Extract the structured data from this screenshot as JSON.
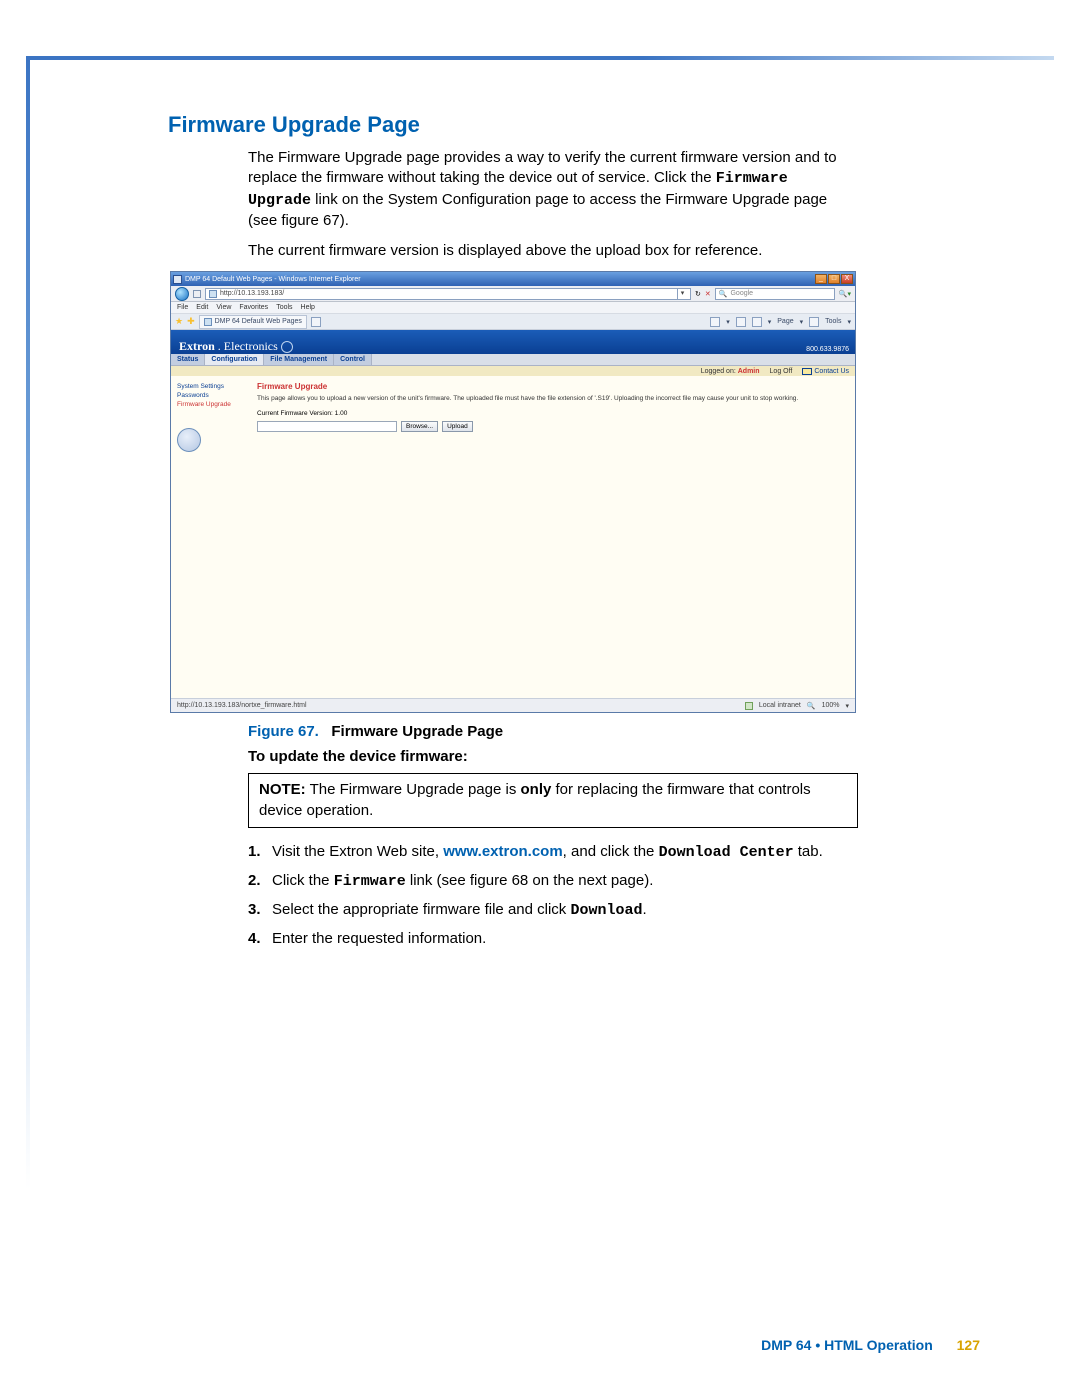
{
  "heading": "Firmware Upgrade Page",
  "para1_part1": "The Firmware Upgrade page provides a way to verify the current firmware version and to replace the firmware without taking the device out of service. Click the ",
  "para1_code": "Firmware Upgrade",
  "para1_part2": " link on the System Configuration page to access the Firmware Upgrade page (see figure 67).",
  "para2": "The current firmware version is displayed above the upload box for reference.",
  "figure": {
    "num": "Figure 67.",
    "title": "Firmware Upgrade Page"
  },
  "subhead": "To update the device firmware:",
  "note_label": "NOTE:",
  "note_text_a": " The Firmware Upgrade page is ",
  "note_bold": "only",
  "note_text_b": " for replacing the firmware that controls device operation.",
  "steps": {
    "s1_a": "Visit the Extron Web site, ",
    "s1_link": "www.extron.com",
    "s1_b": ", and click the ",
    "s1_code": "Download Center",
    "s1_c": " tab.",
    "s2_a": "Click the ",
    "s2_code": "Firmware",
    "s2_b": " link (see figure 68 on the next page).",
    "s3_a": "Select the appropriate firmware file and click ",
    "s3_code": "Download",
    "s3_b": ".",
    "s4": "Enter the requested information."
  },
  "footer": {
    "label": "DMP 64 • HTML Operation",
    "page": "127"
  },
  "ie": {
    "title": "DMP 64 Default Web Pages - Windows Internet Explorer",
    "url": "http://10.13.193.183/",
    "search_hint": "Google",
    "menus": [
      "File",
      "Edit",
      "View",
      "Favorites",
      "Tools",
      "Help"
    ],
    "tab": "DMP 64 Default Web Pages",
    "tools": {
      "page": "Page",
      "tools": "Tools"
    },
    "status_url": "http://10.13.193.183/nortxe_firmware.html",
    "zone": "Local intranet",
    "zoom": "100%"
  },
  "extron": {
    "brand_a": "Extron",
    "brand_b": "Electronics",
    "phone": "800.633.9876",
    "tabs": [
      "Status",
      "Configuration",
      "File Management",
      "Control"
    ],
    "strip": {
      "loggedon_label": "Logged on:",
      "loggedon_user": "Admin",
      "logoff": "Log Off",
      "contact": "Contact Us"
    },
    "sidebar": {
      "l1": "System Settings",
      "l2": "Passwords",
      "l3": "Firmware Upgrade"
    },
    "fw": {
      "title": "Firmware Upgrade",
      "desc": "This page allows you to upload a new version of the unit's firmware. The uploaded file must have the file extension of '.S19'. Uploading the incorrect file may cause your unit to stop working.",
      "version": "Current Firmware Version: 1.00",
      "browse": "Browse...",
      "upload": "Upload"
    }
  }
}
